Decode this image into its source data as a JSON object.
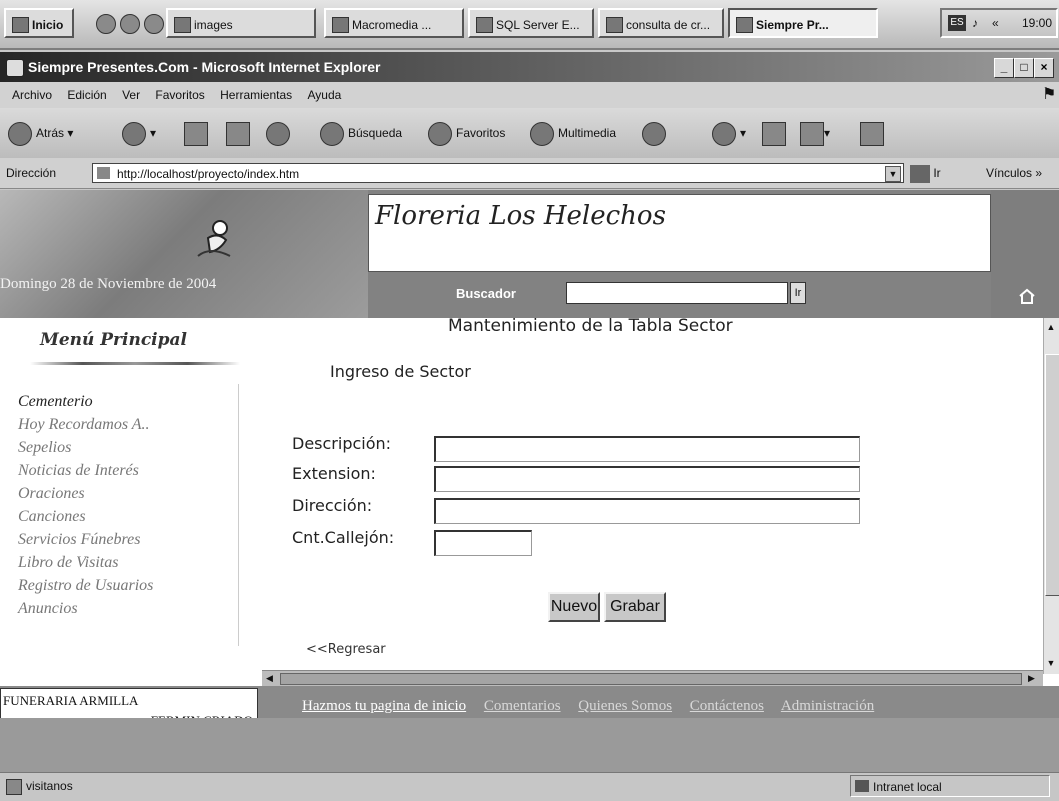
{
  "taskbar": {
    "start_label": "Inicio",
    "buttons": [
      "images",
      "Macromedia ...",
      "SQL Server E...",
      "consulta de cr...",
      "Siempre Pr..."
    ],
    "lang": "ES",
    "clock": "19:00"
  },
  "window": {
    "title": "Siempre Presentes.Com - Microsoft Internet Explorer",
    "menu": [
      "Archivo",
      "Edición",
      "Ver",
      "Favoritos",
      "Herramientas",
      "Ayuda"
    ],
    "toolbar": {
      "back": "Atrás",
      "search": "Búsqueda",
      "favorites": "Favoritos",
      "multimedia": "Multimedia"
    },
    "address_label": "Dirección",
    "address_url": "http://localhost/proyecto/index.htm",
    "go_label": "Ir",
    "links_label": "Vínculos »"
  },
  "header": {
    "florist_name": "Floreria Los Helechos",
    "date": "Domingo 28 de Noviembre de 2004",
    "search_label": "Buscador",
    "search_button": "Ir",
    "search_value": ""
  },
  "sidebar": {
    "title": "Menú Principal",
    "items": [
      {
        "label": "Cementerio"
      },
      {
        "label": "Hoy Recordamos A.."
      },
      {
        "label": "Sepelios"
      },
      {
        "label": "Noticias de Interés"
      },
      {
        "label": "Oraciones"
      },
      {
        "label": "Canciones"
      },
      {
        "label": "Servicios Fúnebres"
      },
      {
        "label": "Libro de Visitas"
      },
      {
        "label": "Registro de Usuarios"
      },
      {
        "label": "Anuncios"
      }
    ]
  },
  "form": {
    "heading": "Mantenimiento de la Tabla Sector",
    "section": "Ingreso de Sector",
    "fields": [
      {
        "label": "Descripción:",
        "value": ""
      },
      {
        "label": "Extension:",
        "value": ""
      },
      {
        "label": "Dirección:",
        "value": ""
      },
      {
        "label": "Cnt.Callejón:",
        "value": ""
      }
    ],
    "btn_new": "Nuevo",
    "btn_save": "Grabar",
    "back_link": "<<Regresar"
  },
  "footer": {
    "company_line1": "FUNERARIA ARMILLA",
    "company_line2": "FERMIN CRIADO",
    "links": [
      "Hazmos tu pagina de inicio",
      "Comentarios",
      "Quienes Somos",
      "Contáctenos",
      "Administración"
    ]
  },
  "status": {
    "text": "visitanos",
    "zone": "Intranet local"
  }
}
